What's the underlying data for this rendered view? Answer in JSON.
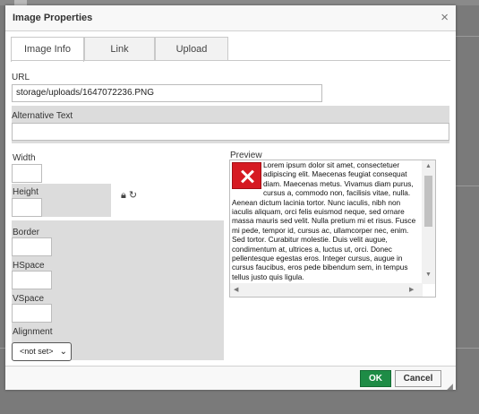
{
  "dialog": {
    "title": "Image Properties",
    "close_glyph": "×"
  },
  "tabs": [
    {
      "label": "Image Info",
      "active": true
    },
    {
      "label": "Link",
      "active": false
    },
    {
      "label": "Upload",
      "active": false
    }
  ],
  "form": {
    "url_label": "URL",
    "url_value": "storage/uploads/1647072236.PNG",
    "alt_label": "Alternative Text",
    "alt_value": "",
    "width_label": "Width",
    "width_value": "",
    "height_label": "Height",
    "height_value": "",
    "lock_icon": "lock-icon",
    "reset_icon": "reset-size-icon",
    "border_label": "Border",
    "border_value": "",
    "hspace_label": "HSpace",
    "hspace_value": "",
    "vspace_label": "VSpace",
    "vspace_value": "",
    "alignment_label": "Alignment",
    "alignment_value": "<not set>"
  },
  "preview": {
    "label": "Preview",
    "text": "Lorem ipsum dolor sit amet, consectetuer adipiscing elit. Maecenas feugiat consequat diam. Maecenas metus. Vivamus diam purus, cursus a, commodo non, facilisis vitae, nulla. Aenean dictum lacinia tortor. Nunc iaculis, nibh non iaculis aliquam, orci felis euismod neque, sed ornare massa mauris sed velit. Nulla pretium mi et risus. Fusce mi pede, tempor id, cursus ac, ullamcorper nec, enim. Sed tortor. Curabitur molestie. Duis velit augue, condimentum at, ultrices a, luctus ut, orci. Donec pellentesque egestas eros. Integer cursus, augue in cursus faucibus, eros pede bibendum sem, in tempus tellus justo quis ligula."
  },
  "buttons": {
    "ok": "OK",
    "cancel": "Cancel"
  },
  "colors": {
    "ok_button": "#1e8c46",
    "broken_image": "#d61a22"
  }
}
